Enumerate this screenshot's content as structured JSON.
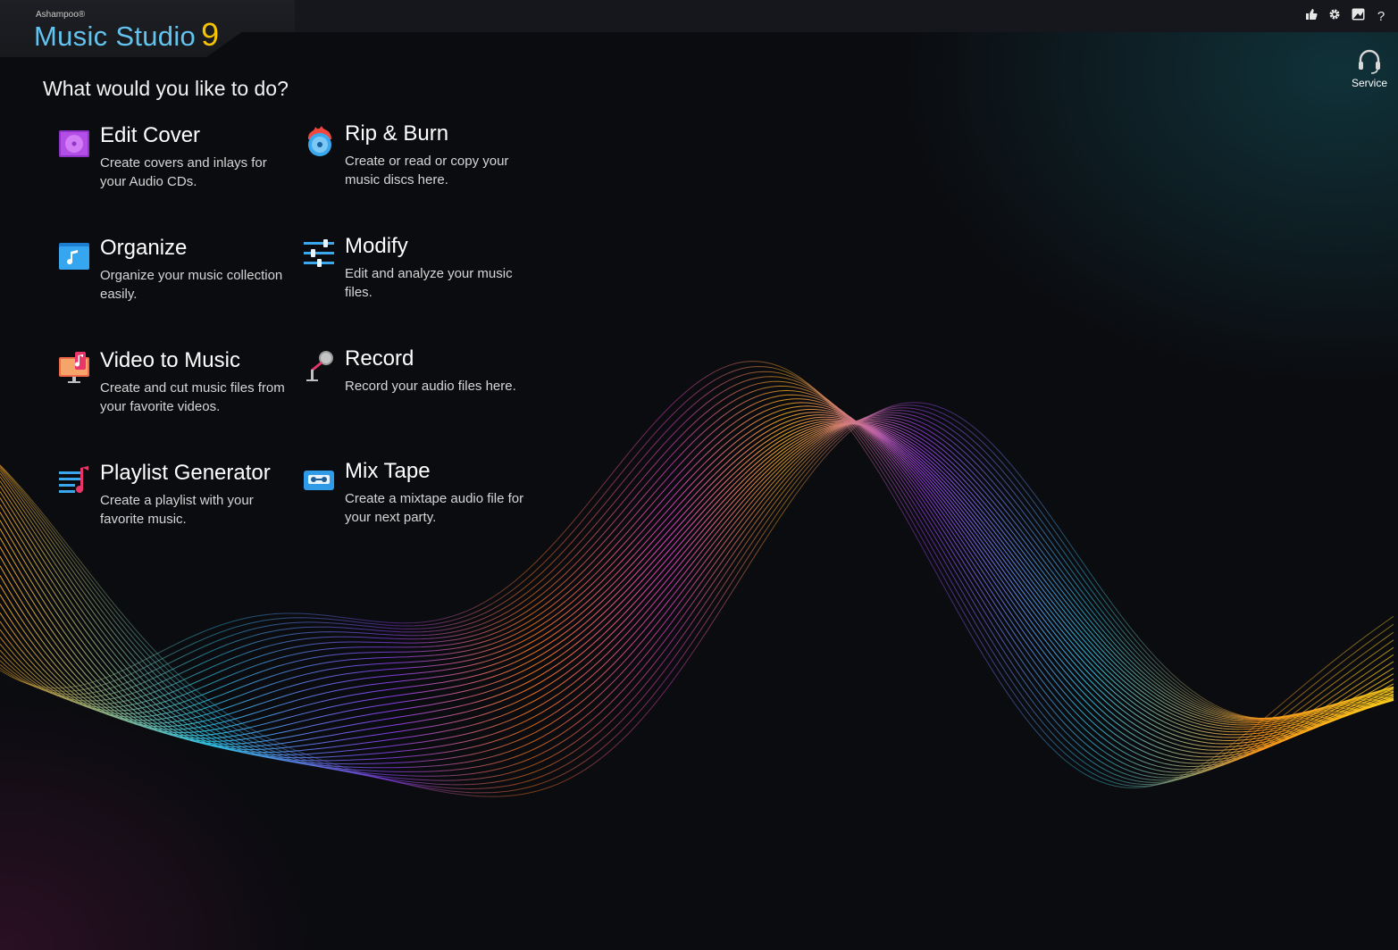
{
  "app": {
    "brand": "Ashampoo®",
    "name": "Music Studio",
    "version": "9"
  },
  "toolbar": {
    "icons": [
      "thumbs-up-icon",
      "gear-icon",
      "image-icon",
      "help-icon"
    ],
    "help_label": "?"
  },
  "service": {
    "label": "Service",
    "icon": "headset-icon"
  },
  "heading": "What would you like to do?",
  "tiles": [
    {
      "title": "Edit Cover",
      "desc": "Create covers and inlays for your Audio CDs.",
      "icon": "cover-icon"
    },
    {
      "title": "Rip & Burn",
      "desc": "Create or read or copy your music discs here.",
      "icon": "disc-flame-icon"
    },
    {
      "title": "Organize",
      "desc": "Organize your music collection easily.",
      "icon": "music-folder-icon"
    },
    {
      "title": "Modify",
      "desc": "Edit and analyze your music files.",
      "icon": "sliders-icon"
    },
    {
      "title": "Video to Music",
      "desc": "Create and cut music files from your favorite videos.",
      "icon": "video-music-icon"
    },
    {
      "title": "Record",
      "desc": "Record your audio files here.",
      "icon": "microphone-icon"
    },
    {
      "title": "Playlist Generator",
      "desc": "Create a playlist with your favorite music.",
      "icon": "playlist-icon"
    },
    {
      "title": "Mix Tape",
      "desc": "Create a mixtape audio file for your next party.",
      "icon": "cassette-icon"
    }
  ],
  "colors": {
    "accent_blue": "#62c3ee",
    "accent_yellow": "#f5c400",
    "background": "#0b0c10"
  }
}
